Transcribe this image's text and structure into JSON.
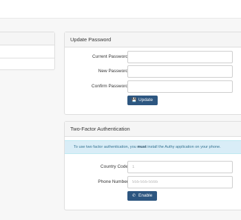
{
  "update_password": {
    "heading": "Update Password",
    "current_label": "Current Password",
    "current_value": "",
    "new_label": "New Password",
    "new_value": "",
    "confirm_label": "Confirm Password",
    "confirm_value": "",
    "button_label": "Update",
    "button_icon": "save-icon"
  },
  "two_factor": {
    "heading": "Two-Factor Authentication",
    "info_prefix": "To use two factor authentication, you ",
    "info_emphasis": "must",
    "info_suffix": " install the Authy application on your phone.",
    "country_label": "Country Code",
    "country_placeholder": "1",
    "phone_label": "Phone Number",
    "phone_placeholder": "555-555-5555",
    "button_label": "Enable",
    "button_icon": "phone-icon"
  },
  "colors": {
    "button": "#2d5680",
    "info_bg": "#d9edf7",
    "info_text": "#31708f"
  }
}
